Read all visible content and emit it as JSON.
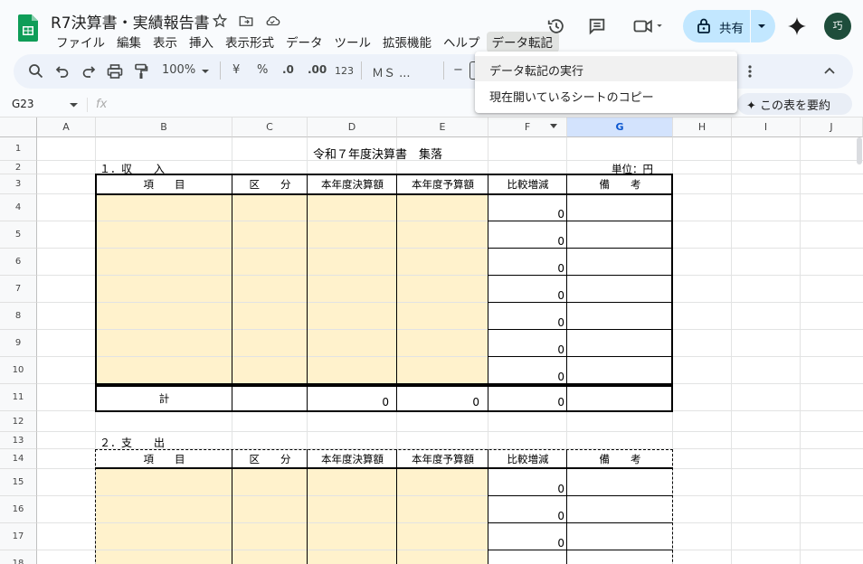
{
  "window": {
    "doc_title": "R7決算書・実績報告書",
    "menu": [
      "ファイル",
      "編集",
      "表示",
      "挿入",
      "表示形式",
      "データ",
      "ツール",
      "拡張機能",
      "ヘルプ",
      "データ転記"
    ],
    "active_menu_index": 9,
    "share_label": "共有",
    "avatar_text": "巧"
  },
  "toolbar": {
    "zoom": "100%",
    "currency": "¥",
    "percent": "%",
    "dec_decrease": ".0",
    "dec_increase": ".00",
    "number_format": "123",
    "font_name": "ＭＳ ...",
    "font_minus": "−"
  },
  "formula_bar": {
    "name_box": "G23",
    "fx": "fx",
    "summarize_label": "この表を要約"
  },
  "dropdown": {
    "items": [
      "データ転記の実行",
      "現在開いているシートのコピー"
    ]
  },
  "grid": {
    "columns": [
      "A",
      "B",
      "C",
      "D",
      "E",
      "F",
      "G",
      "H",
      "I",
      "J"
    ],
    "selected_column": "G",
    "rows": [
      "1",
      "2",
      "3",
      "4",
      "5",
      "6",
      "7",
      "8",
      "9",
      "10",
      "11",
      "12",
      "13",
      "14",
      "15",
      "16",
      "17",
      "18"
    ]
  },
  "sheet": {
    "title": "令和７年度決算書　集落",
    "section1": "１．収　　入",
    "unit": "単位：円",
    "headers": [
      "項　　目",
      "区　　分",
      "本年度決算額",
      "本年度予算額",
      "比較増減",
      "備　　考"
    ],
    "income_diffs": [
      "0",
      "0",
      "0",
      "0",
      "0",
      "0",
      "0"
    ],
    "total_label": "計",
    "total_values": [
      "0",
      "0",
      "0"
    ],
    "section2": "２．支　　出",
    "expense_diffs": [
      "0",
      "0",
      "0"
    ]
  },
  "colors": {
    "input_fill": "#fff2cc",
    "share_bg": "#c2e7ff",
    "avatar_bg": "#1e4d3b",
    "selected_col": "#d3e3fd",
    "sheets_green": "#0f9d58"
  }
}
